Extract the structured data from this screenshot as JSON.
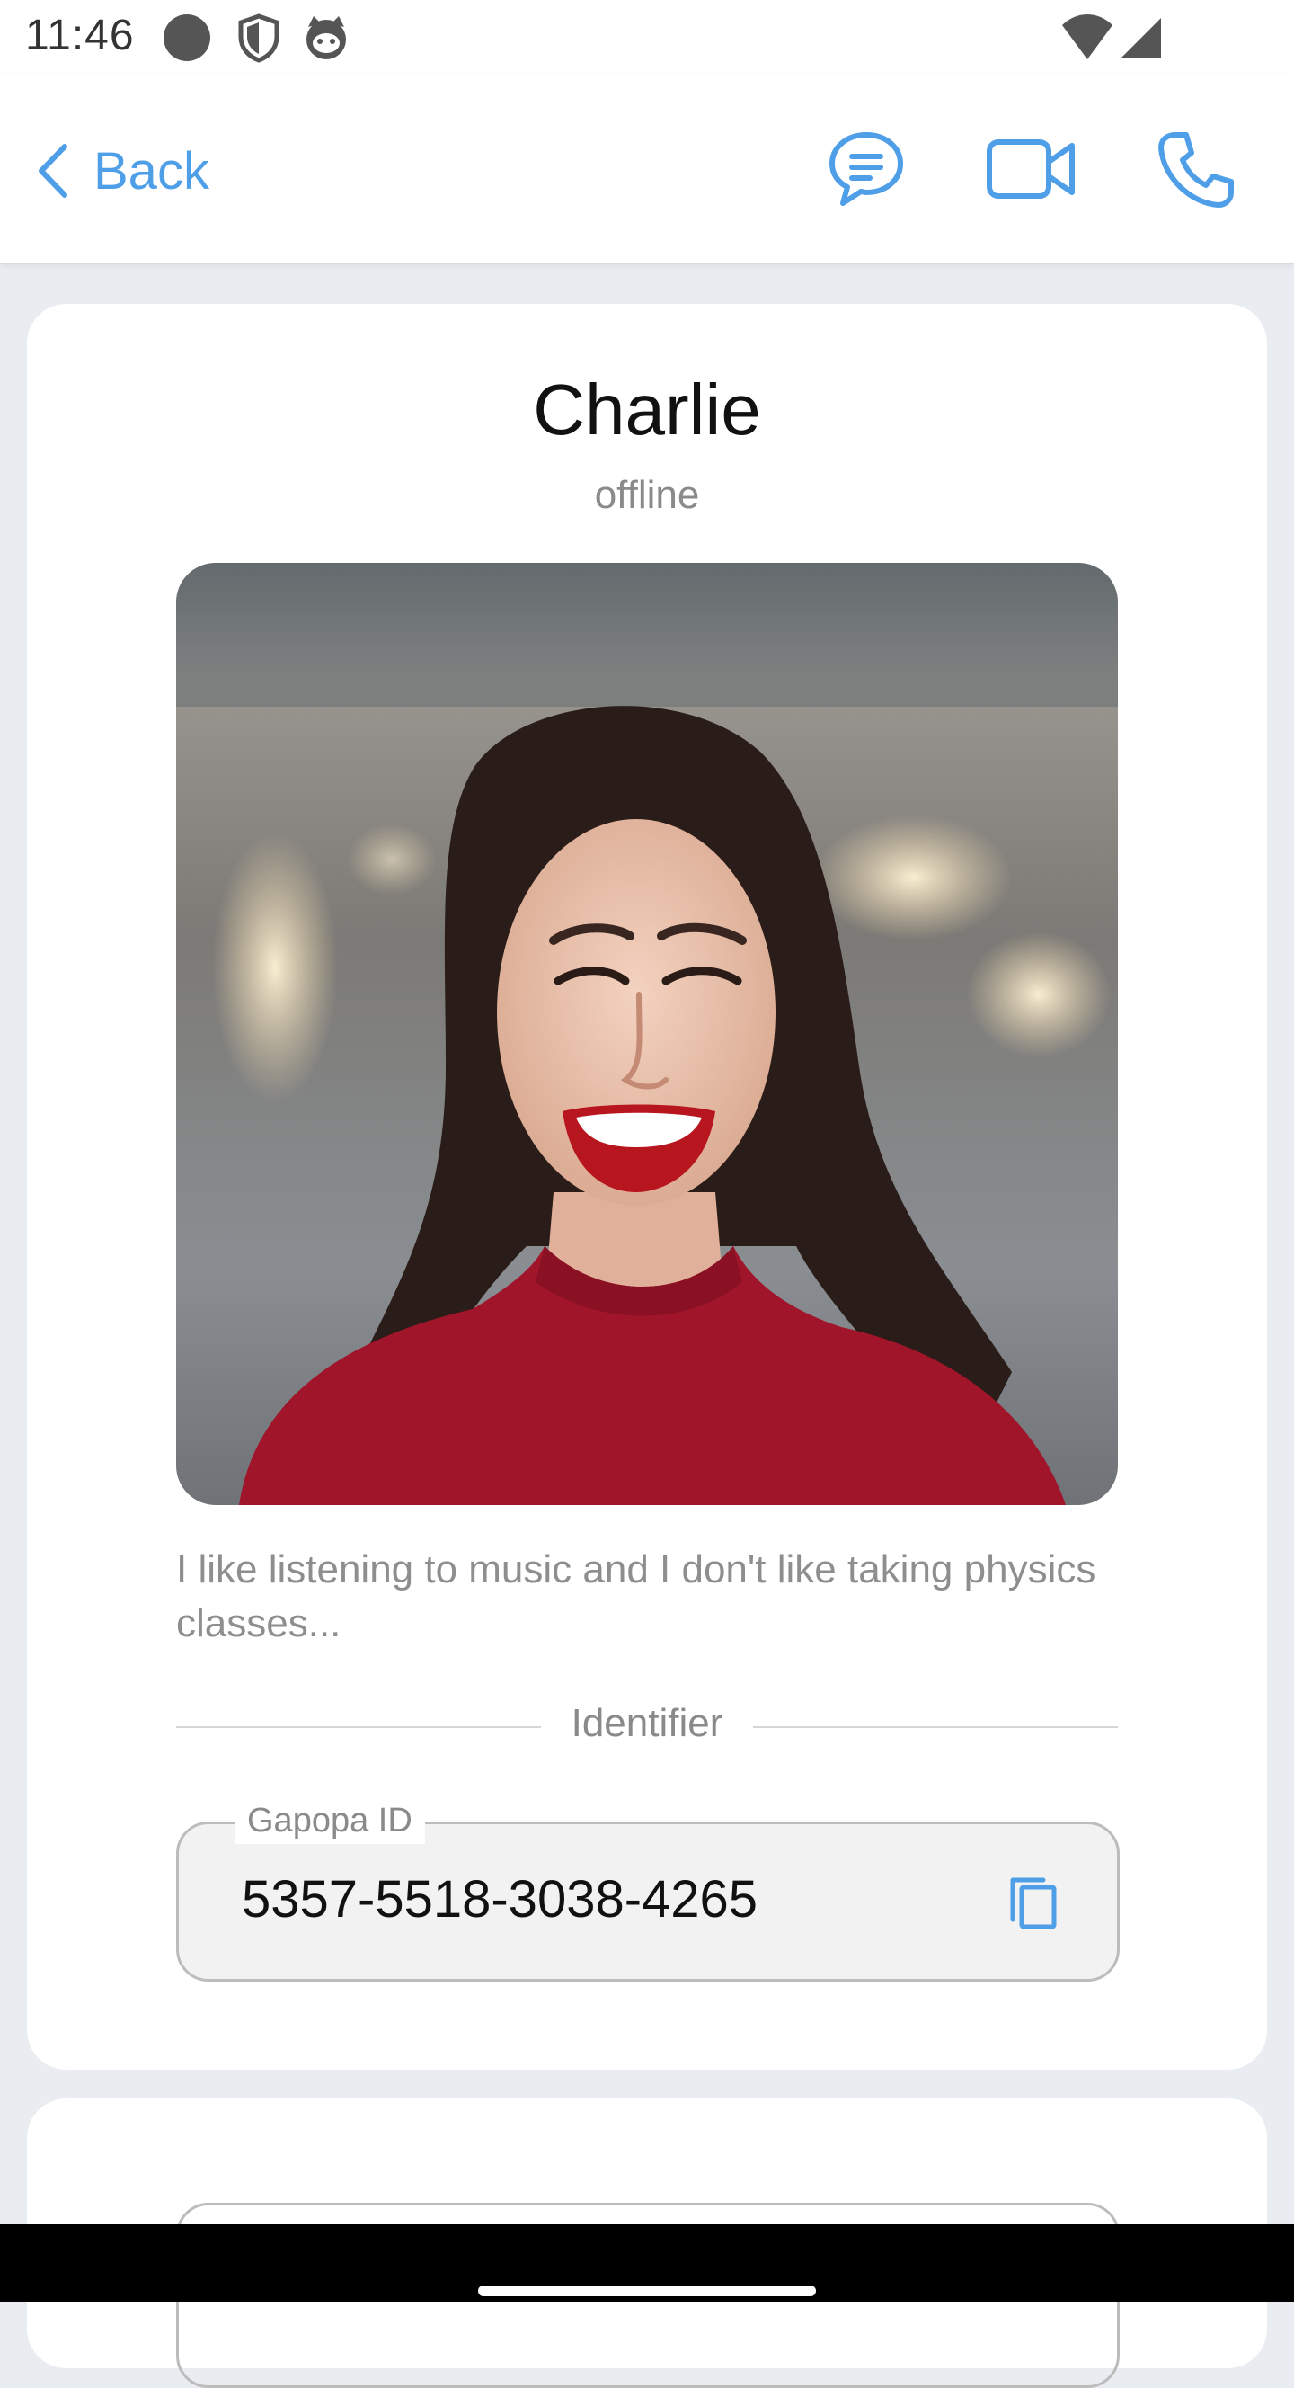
{
  "status_bar": {
    "time": "11:46",
    "icons": [
      "record-dot-icon",
      "shield-icon",
      "cat-face-icon",
      "wifi-icon",
      "cellular-signal-icon"
    ]
  },
  "app_bar": {
    "back_label": "Back",
    "actions": [
      "chat-bubble-icon",
      "video-camera-icon",
      "phone-icon"
    ],
    "accent_color": "#4f9ee8"
  },
  "profile": {
    "name": "Charlie",
    "status": "offline",
    "bio": "I like listening to music and I don't like taking physics classes...",
    "divider_label": "Identifier",
    "id_field": {
      "label": "Gapopa ID",
      "value": "5357-5518-3038-4265"
    }
  }
}
